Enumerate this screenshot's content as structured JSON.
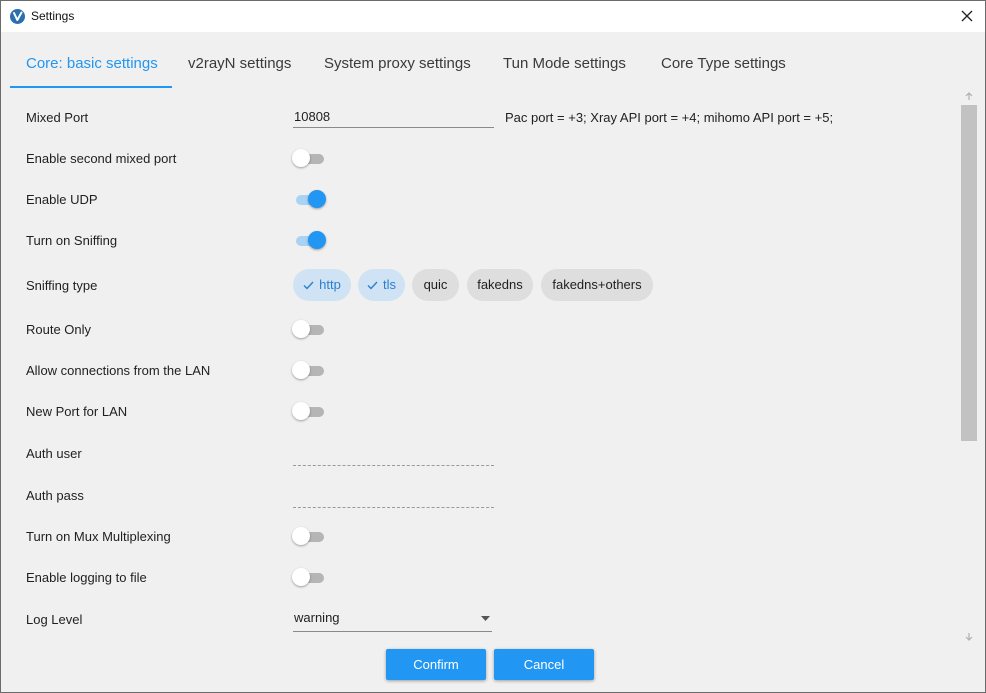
{
  "window": {
    "title": "Settings"
  },
  "tabs": [
    {
      "label": "Core: basic settings",
      "active": true
    },
    {
      "label": "v2rayN settings",
      "active": false
    },
    {
      "label": "System proxy settings",
      "active": false
    },
    {
      "label": "Tun Mode settings",
      "active": false
    },
    {
      "label": "Core Type settings",
      "active": false
    }
  ],
  "settings": {
    "mixed_port": {
      "label": "Mixed Port",
      "value": "10808",
      "hint": "Pac port = +3; Xray API port = +4; mihomo API port = +5;"
    },
    "second_mixed_port": {
      "label": "Enable second mixed port",
      "on": false
    },
    "udp": {
      "label": "Enable UDP",
      "on": true
    },
    "sniffing": {
      "label": "Turn on Sniffing",
      "on": true
    },
    "sniffing_type": {
      "label": "Sniffing type",
      "options": [
        {
          "label": "http",
          "selected": true
        },
        {
          "label": "tls",
          "selected": true
        },
        {
          "label": "quic",
          "selected": false
        },
        {
          "label": "fakedns",
          "selected": false
        },
        {
          "label": "fakedns+others",
          "selected": false
        }
      ]
    },
    "route_only": {
      "label": "Route Only",
      "on": false
    },
    "allow_lan": {
      "label": "Allow connections from the LAN",
      "on": false
    },
    "new_port_lan": {
      "label": "New Port for LAN",
      "on": false
    },
    "auth_user": {
      "label": "Auth user",
      "value": ""
    },
    "auth_pass": {
      "label": "Auth pass",
      "value": ""
    },
    "mux": {
      "label": "Turn on Mux Multiplexing",
      "on": false
    },
    "logging": {
      "label": "Enable logging to file",
      "on": false
    },
    "log_level": {
      "label": "Log Level",
      "value": "warning"
    }
  },
  "buttons": {
    "confirm": "Confirm",
    "cancel": "Cancel"
  },
  "colors": {
    "accent": "#2196f3",
    "chip_selected_bg": "#cfe3f4",
    "chip_bg": "#dedede",
    "toggle_off": "#b5b5b5"
  }
}
